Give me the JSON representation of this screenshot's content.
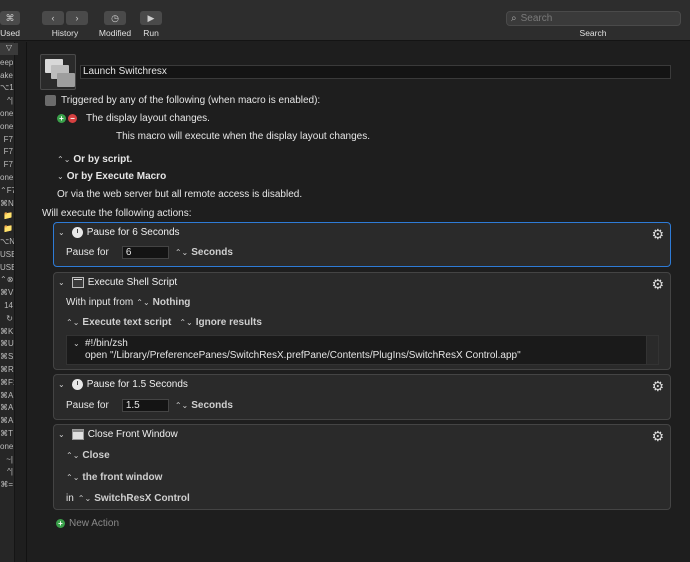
{
  "toolbar": {
    "used_label": "Used",
    "history_label": "History",
    "modified_label": "Modified",
    "run_label": "Run",
    "search_label": "Search",
    "search_placeholder": "Search"
  },
  "left_strip": {
    "items": [
      "⌥=",
      "eep",
      "ake",
      "⌥1",
      "^|",
      "one",
      "one",
      "F7",
      "F7",
      "F7",
      "one",
      "⌃F7",
      "⌘N",
      "📁",
      "📁",
      "⌥N",
      "USB",
      "USB",
      "⌃⊗",
      "⌘V",
      "14",
      "↻",
      "⌘K",
      "⌘U",
      "⌘S",
      "⌘R",
      "⌘F1",
      "⌘A",
      "⌘A",
      "⌘A",
      "⌘T",
      "one",
      "~|",
      "^|",
      "⌘="
    ]
  },
  "macro": {
    "name": "Launch Switchresx",
    "trigger_text": "Triggered by any of the following (when macro is enabled):",
    "trigger_item": "The display layout changes.",
    "trigger_desc": "This macro will execute when the display layout changes.",
    "or_script": "Or by script.",
    "or_execute": "Or by Execute Macro",
    "web_server": "Or via the web server but all remote access is disabled.",
    "will_execute": "Will execute the following actions:"
  },
  "actions": [
    {
      "title": "Pause for 6 Seconds",
      "pause_label": "Pause for",
      "value": "6",
      "unit": "Seconds"
    },
    {
      "title": "Execute Shell Script",
      "input_label": "With input from",
      "input_value": "Nothing",
      "mode": "Execute text script",
      "results": "Ignore results",
      "script_line1": "#!/bin/zsh",
      "script_line2": "open \"/Library/PreferencePanes/SwitchResX.prefPane/Contents/PlugIns/SwitchResX Control.app\""
    },
    {
      "title": "Pause for 1.5 Seconds",
      "pause_label": "Pause for",
      "value": "1.5",
      "unit": "Seconds"
    },
    {
      "title": "Close Front Window",
      "action": "Close",
      "target": "the front window",
      "in_label": "in",
      "app": "SwitchResX Control"
    }
  ],
  "new_action": "New Action"
}
